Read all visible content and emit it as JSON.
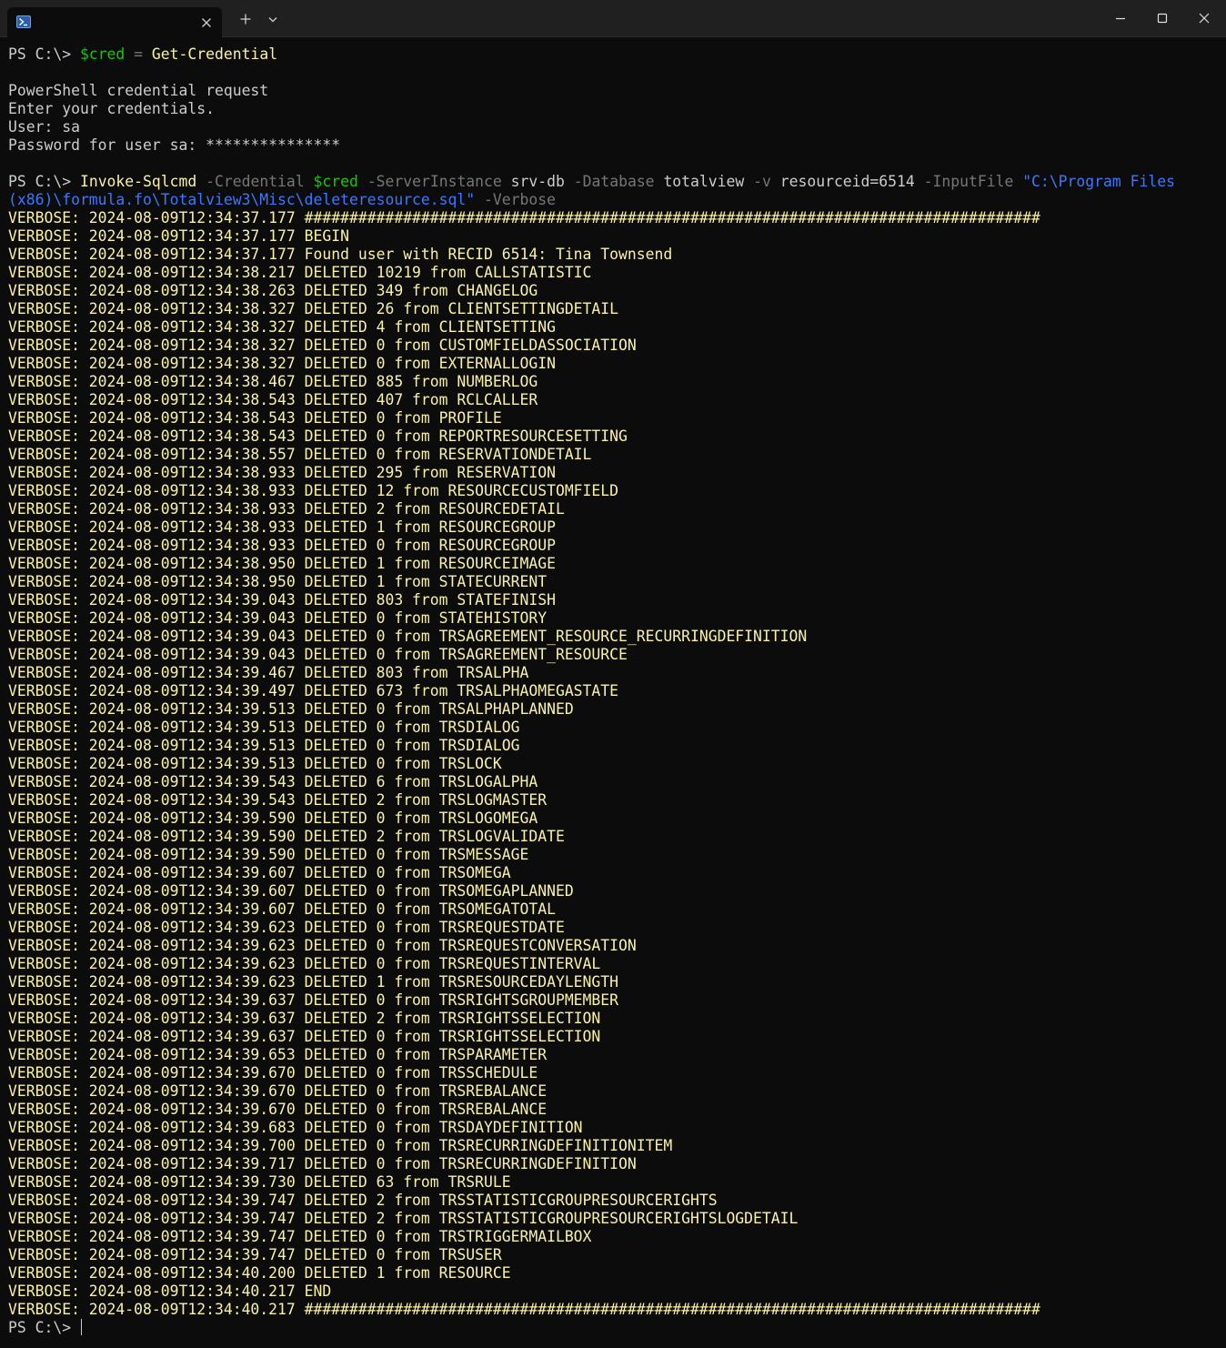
{
  "window": {
    "tab_title": "",
    "colors": {
      "background": "#0c0c0c",
      "titlebar": "#202020",
      "text": "#cccccc",
      "variable": "#16c60c",
      "command": "#f9f1a5",
      "parameter": "#767676",
      "string": "#3b78ff",
      "verbose": "#f9f1a5"
    },
    "icons": {
      "tab": "powershell-icon",
      "close": "close-icon",
      "new_tab": "plus-icon",
      "dropdown": "chevron-down-icon",
      "minimize": "minimize-icon",
      "maximize": "maximize-icon",
      "window_close": "close-icon"
    }
  },
  "session": {
    "prompt": "PS C:\\> ",
    "cmd1": {
      "var": "$cred",
      "op": " = ",
      "command": "Get-Credential"
    },
    "credential_request": [
      "PowerShell credential request",
      "Enter your credentials.",
      "User: sa",
      "Password for user sa: ***************"
    ],
    "cmd2": {
      "command": "Invoke-Sqlcmd",
      "p_credential": " -Credential ",
      "var": "$cred",
      "p_server": " -ServerInstance ",
      "server": "srv-db",
      "p_database": " -Database ",
      "database": "totalview",
      "p_v": " -v ",
      "v_value": "resourceid=6514",
      "p_input": " -InputFile ",
      "path_part1": "\"C:\\Program Files",
      "path_part2": "(x86)\\formula.fo\\Totalview3\\Misc\\deleteresource.sql\"",
      "p_verbose": " -Verbose"
    },
    "verbose_lines": [
      "VERBOSE: 2024-08-09T12:34:37.177 ##################################################################################",
      "VERBOSE: 2024-08-09T12:34:37.177 BEGIN",
      "VERBOSE: 2024-08-09T12:34:37.177 Found user with RECID 6514: Tina Townsend",
      "VERBOSE: 2024-08-09T12:34:38.217 DELETED 10219 from CALLSTATISTIC",
      "VERBOSE: 2024-08-09T12:34:38.263 DELETED 349 from CHANGELOG",
      "VERBOSE: 2024-08-09T12:34:38.327 DELETED 26 from CLIENTSETTINGDETAIL",
      "VERBOSE: 2024-08-09T12:34:38.327 DELETED 4 from CLIENTSETTING",
      "VERBOSE: 2024-08-09T12:34:38.327 DELETED 0 from CUSTOMFIELDASSOCIATION",
      "VERBOSE: 2024-08-09T12:34:38.327 DELETED 0 from EXTERNALLOGIN",
      "VERBOSE: 2024-08-09T12:34:38.467 DELETED 885 from NUMBERLOG",
      "VERBOSE: 2024-08-09T12:34:38.543 DELETED 407 from RCLCALLER",
      "VERBOSE: 2024-08-09T12:34:38.543 DELETED 0 from PROFILE",
      "VERBOSE: 2024-08-09T12:34:38.543 DELETED 0 from REPORTRESOURCESETTING",
      "VERBOSE: 2024-08-09T12:34:38.557 DELETED 0 from RESERVATIONDETAIL",
      "VERBOSE: 2024-08-09T12:34:38.933 DELETED 295 from RESERVATION",
      "VERBOSE: 2024-08-09T12:34:38.933 DELETED 12 from RESOURCECUSTOMFIELD",
      "VERBOSE: 2024-08-09T12:34:38.933 DELETED 2 from RESOURCEDETAIL",
      "VERBOSE: 2024-08-09T12:34:38.933 DELETED 1 from RESOURCEGROUP",
      "VERBOSE: 2024-08-09T12:34:38.933 DELETED 0 from RESOURCEGROUP",
      "VERBOSE: 2024-08-09T12:34:38.950 DELETED 1 from RESOURCEIMAGE",
      "VERBOSE: 2024-08-09T12:34:38.950 DELETED 1 from STATECURRENT",
      "VERBOSE: 2024-08-09T12:34:39.043 DELETED 803 from STATEFINISH",
      "VERBOSE: 2024-08-09T12:34:39.043 DELETED 0 from STATEHISTORY",
      "VERBOSE: 2024-08-09T12:34:39.043 DELETED 0 from TRSAGREEMENT_RESOURCE_RECURRINGDEFINITION",
      "VERBOSE: 2024-08-09T12:34:39.043 DELETED 0 from TRSAGREEMENT_RESOURCE",
      "VERBOSE: 2024-08-09T12:34:39.467 DELETED 803 from TRSALPHA",
      "VERBOSE: 2024-08-09T12:34:39.497 DELETED 673 from TRSALPHAOMEGASTATE",
      "VERBOSE: 2024-08-09T12:34:39.513 DELETED 0 from TRSALPHAPLANNED",
      "VERBOSE: 2024-08-09T12:34:39.513 DELETED 0 from TRSDIALOG",
      "VERBOSE: 2024-08-09T12:34:39.513 DELETED 0 from TRSDIALOG",
      "VERBOSE: 2024-08-09T12:34:39.513 DELETED 0 from TRSLOCK",
      "VERBOSE: 2024-08-09T12:34:39.543 DELETED 6 from TRSLOGALPHA",
      "VERBOSE: 2024-08-09T12:34:39.543 DELETED 2 from TRSLOGMASTER",
      "VERBOSE: 2024-08-09T12:34:39.590 DELETED 0 from TRSLOGOMEGA",
      "VERBOSE: 2024-08-09T12:34:39.590 DELETED 2 from TRSLOGVALIDATE",
      "VERBOSE: 2024-08-09T12:34:39.590 DELETED 0 from TRSMESSAGE",
      "VERBOSE: 2024-08-09T12:34:39.607 DELETED 0 from TRSOMEGA",
      "VERBOSE: 2024-08-09T12:34:39.607 DELETED 0 from TRSOMEGAPLANNED",
      "VERBOSE: 2024-08-09T12:34:39.607 DELETED 0 from TRSOMEGATOTAL",
      "VERBOSE: 2024-08-09T12:34:39.623 DELETED 0 from TRSREQUESTDATE",
      "VERBOSE: 2024-08-09T12:34:39.623 DELETED 0 from TRSREQUESTCONVERSATION",
      "VERBOSE: 2024-08-09T12:34:39.623 DELETED 0 from TRSREQUESTINTERVAL",
      "VERBOSE: 2024-08-09T12:34:39.623 DELETED 1 from TRSRESOURCEDAYLENGTH",
      "VERBOSE: 2024-08-09T12:34:39.637 DELETED 0 from TRSRIGHTSGROUPMEMBER",
      "VERBOSE: 2024-08-09T12:34:39.637 DELETED 2 from TRSRIGHTSSELECTION",
      "VERBOSE: 2024-08-09T12:34:39.637 DELETED 0 from TRSRIGHTSSELECTION",
      "VERBOSE: 2024-08-09T12:34:39.653 DELETED 0 from TRSPARAMETER",
      "VERBOSE: 2024-08-09T12:34:39.670 DELETED 0 from TRSSCHEDULE",
      "VERBOSE: 2024-08-09T12:34:39.670 DELETED 0 from TRSREBALANCE",
      "VERBOSE: 2024-08-09T12:34:39.670 DELETED 0 from TRSREBALANCE",
      "VERBOSE: 2024-08-09T12:34:39.683 DELETED 0 from TRSDAYDEFINITION",
      "VERBOSE: 2024-08-09T12:34:39.700 DELETED 0 from TRSRECURRINGDEFINITIONITEM",
      "VERBOSE: 2024-08-09T12:34:39.717 DELETED 0 from TRSRECURRINGDEFINITION",
      "VERBOSE: 2024-08-09T12:34:39.730 DELETED 63 from TRSRULE",
      "VERBOSE: 2024-08-09T12:34:39.747 DELETED 2 from TRSSTATISTICGROUPRESOURCERIGHTS",
      "VERBOSE: 2024-08-09T12:34:39.747 DELETED 2 from TRSSTATISTICGROUPRESOURCERIGHTSLOGDETAIL",
      "VERBOSE: 2024-08-09T12:34:39.747 DELETED 0 from TRSTRIGGERMAILBOX",
      "VERBOSE: 2024-08-09T12:34:39.747 DELETED 0 from TRSUSER",
      "VERBOSE: 2024-08-09T12:34:40.200 DELETED 1 from RESOURCE",
      "VERBOSE: 2024-08-09T12:34:40.217 END",
      "VERBOSE: 2024-08-09T12:34:40.217 ##################################################################################"
    ]
  }
}
